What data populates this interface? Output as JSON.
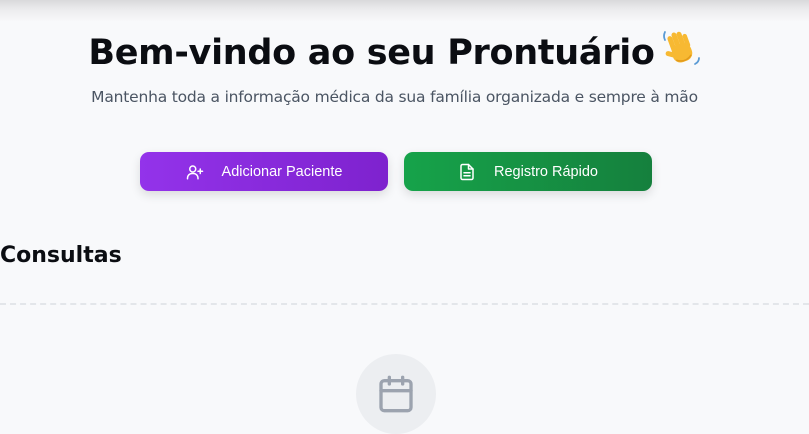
{
  "header": {
    "title": "Bem-vindo ao seu Prontuário",
    "emoji_icon": "waving-hand-icon",
    "subtitle": "Mantenha toda a informação médica da sua família organizada e sempre à mão"
  },
  "actions": {
    "add_patient": {
      "label": "Adicionar Paciente",
      "icon": "user-plus-icon",
      "color": "#9333ea"
    },
    "quick_record": {
      "label": "Registro Rápido",
      "icon": "file-text-icon",
      "color": "#16a34a"
    }
  },
  "consultations": {
    "heading": "Consultas",
    "empty_icon": "calendar-icon"
  }
}
